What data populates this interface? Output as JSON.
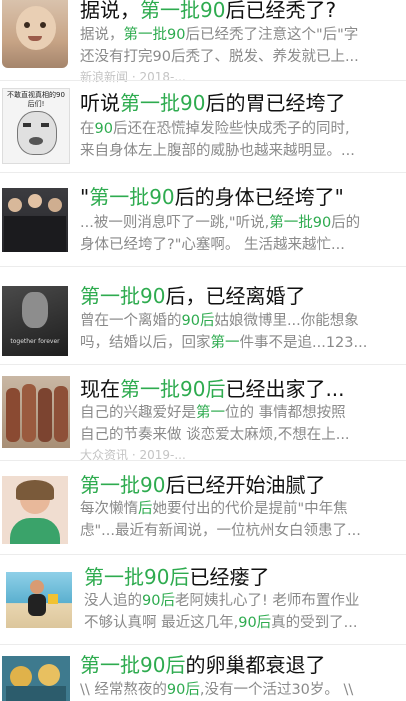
{
  "results": [
    {
      "title_parts": [
        "据说，",
        "第一批90",
        "后已经秃了?"
      ],
      "title_hl": [
        false,
        true,
        false
      ],
      "line1_parts": [
        "据说，",
        "第一批90",
        "后已经秃了注意这个\"后\"字"
      ],
      "line1_hl": [
        false,
        true,
        false
      ],
      "line2_parts": [
        "还没有打完90后秃了、脱发、养发就已上..."
      ],
      "line2_hl": [
        false
      ],
      "meta": "新浪新闻 · 2018-..."
    },
    {
      "title_parts": [
        "听说",
        "第一批90",
        "后的胃已经垮了"
      ],
      "title_hl": [
        false,
        true,
        false
      ],
      "line1_parts": [
        "在",
        "90",
        "后还在恐慌掉发险些快成秃子的同时,"
      ],
      "line1_hl": [
        false,
        true,
        false
      ],
      "line2_parts": [
        "来自身体左上腹部的威胁也越来越明显。..."
      ],
      "line2_hl": [
        false
      ],
      "thumb_caption": "不敢直视真相的90后们!"
    },
    {
      "title_parts": [
        "\"",
        "第一批90",
        "后的身体已经垮了\""
      ],
      "title_hl": [
        false,
        true,
        false
      ],
      "line1_parts": [
        "...被一则消息吓了一跳,\"听说,",
        "第一批90",
        "后的"
      ],
      "line1_hl": [
        false,
        true,
        false
      ],
      "line2_parts": [
        "身体已经垮了?\"心塞啊。 生活越来越忙..."
      ],
      "line2_hl": [
        false
      ]
    },
    {
      "title_parts": [
        "第一批90",
        "后，已经离婚了"
      ],
      "title_hl": [
        true,
        false
      ],
      "line1_parts": [
        "曾在一个离婚的",
        "90后",
        "姑娘微博里...你能想象"
      ],
      "line1_hl": [
        false,
        true,
        false
      ],
      "line2_parts": [
        "吗，结婚以后，回家",
        "第一",
        "件事不是追...123..."
      ],
      "line2_hl": [
        false,
        true,
        false
      ],
      "thumb_caption": "together forever"
    },
    {
      "title_parts": [
        "现在",
        "第一批90后",
        "已经出家了..."
      ],
      "title_hl": [
        false,
        true,
        false
      ],
      "line1_parts": [
        "自己的兴趣爱好是",
        "第一",
        "位的 事情都想按照"
      ],
      "line1_hl": [
        false,
        true,
        false
      ],
      "line2_parts": [
        "自己的节奏来做 谈恋爱太麻烦,不想在上..."
      ],
      "line2_hl": [
        false
      ],
      "meta": "大众资讯 · 2019-..."
    },
    {
      "title_parts": [
        "第一批90",
        "后已经开始油腻了"
      ],
      "title_hl": [
        true,
        false
      ],
      "line1_parts": [
        "每次懒惰",
        "后",
        "她要付出的代价是提前\"中年焦"
      ],
      "line1_hl": [
        false,
        true,
        false
      ],
      "line2_parts": [
        "虑\"...最近有新闻说，一位杭州女白领患了..."
      ],
      "line2_hl": [
        false
      ]
    },
    {
      "title_parts": [
        "第一批90后",
        "已经瘘了"
      ],
      "title_hl": [
        true,
        false
      ],
      "line1_parts": [
        "没人追的",
        "90后",
        "老阿姨扎心了! 老师布置作业"
      ],
      "line1_hl": [
        false,
        true,
        false
      ],
      "line2_parts": [
        "不够认真啊 最近这几年,",
        "90后",
        "真的受到了..."
      ],
      "line2_hl": [
        false,
        true,
        false
      ]
    },
    {
      "title_parts": [
        "第一批90后",
        "的卵巢都衰退了"
      ],
      "title_hl": [
        true,
        false
      ],
      "line1_parts": [
        "\\\\ 经常熬夜的",
        "90后",
        ",没有一个活过30岁。 \\\\"
      ],
      "line1_hl": [
        false,
        true,
        false
      ]
    }
  ]
}
